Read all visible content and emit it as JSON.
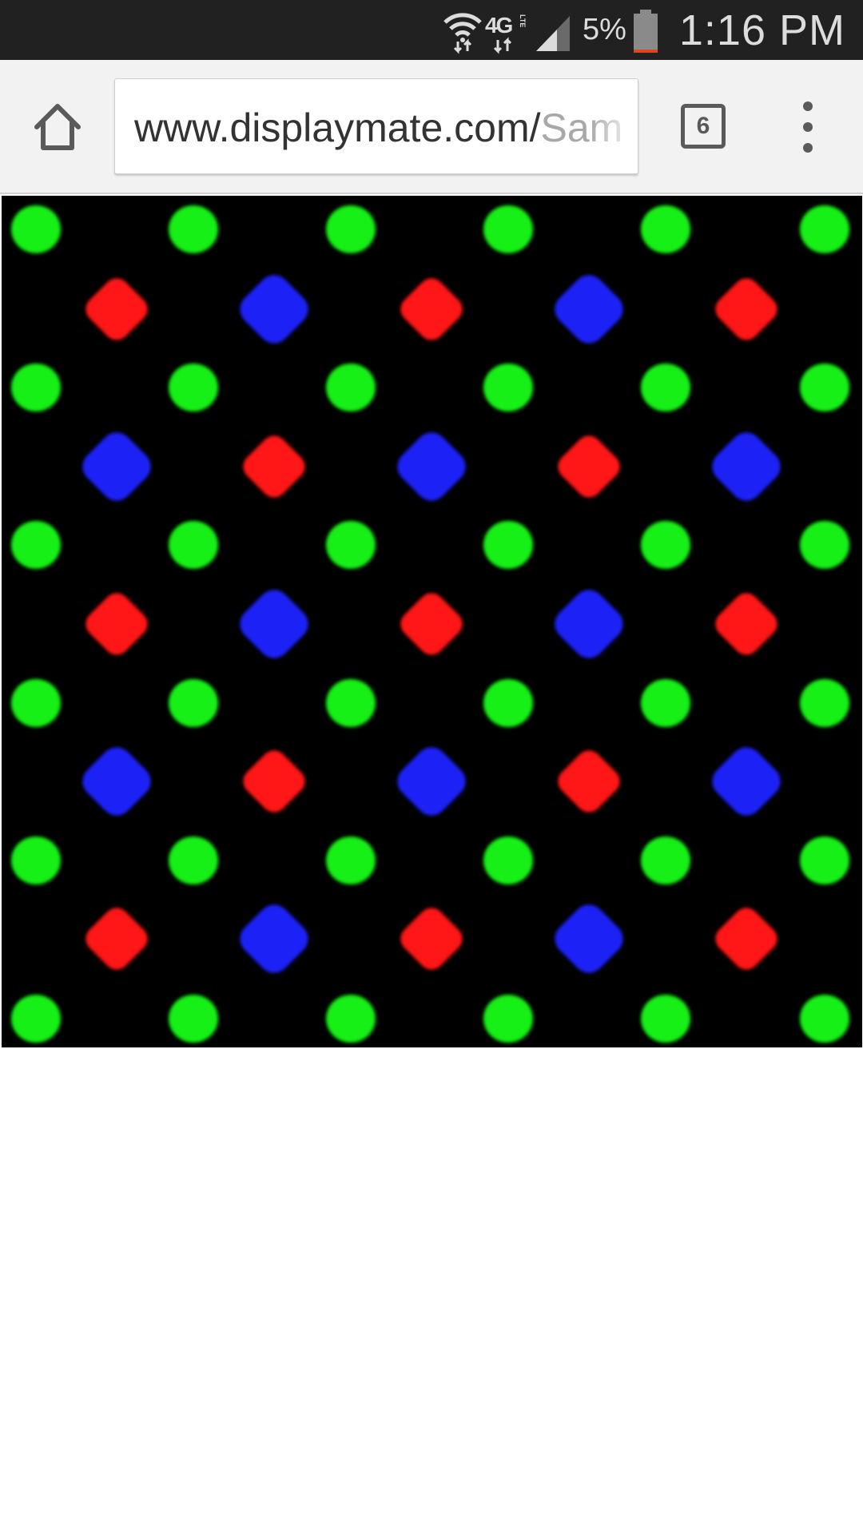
{
  "status_bar": {
    "network_label": "4G",
    "network_sublabel": "LTE",
    "battery_percent": "5%",
    "time": "1:16 PM",
    "icons": [
      "wifi-icon",
      "lte-data-icon",
      "cell-signal-icon",
      "battery-low-icon"
    ]
  },
  "toolbar": {
    "url_domain": "www.displaymate.com/",
    "url_path": "Sam",
    "tab_count": "6",
    "icons": [
      "home-icon",
      "tab-switcher-icon",
      "overflow-menu-icon"
    ]
  },
  "content": {
    "image_subject": "subpixel-pattern-photo",
    "colors": {
      "background": "#000000",
      "green": "#12f012",
      "red": "#ff1616",
      "blue": "#1c24f6"
    }
  }
}
